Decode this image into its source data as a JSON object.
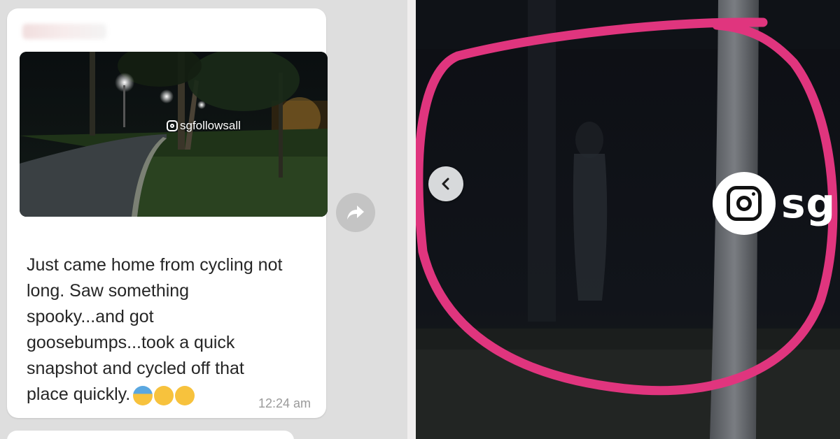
{
  "chat": {
    "watermark": "sgfollowsall",
    "message": "Just came home from cycling not\nlong. Saw something\nspooky...and got\ngoosebumps...took a quick\nsnapshot and cycled off that\nplace quickly.",
    "timestamp": "12:24 am",
    "emojis": [
      "fearful-face-emoji",
      "worried-face-emoji",
      "weary-face-emoji"
    ]
  },
  "zoom_view": {
    "watermark_partial": "sg",
    "circle_color": "#e0357e"
  },
  "colors": {
    "bubble": "#ffffff",
    "background": "#dedede",
    "timestamp": "#9a9a9a",
    "night_sky": "#0e1014"
  }
}
